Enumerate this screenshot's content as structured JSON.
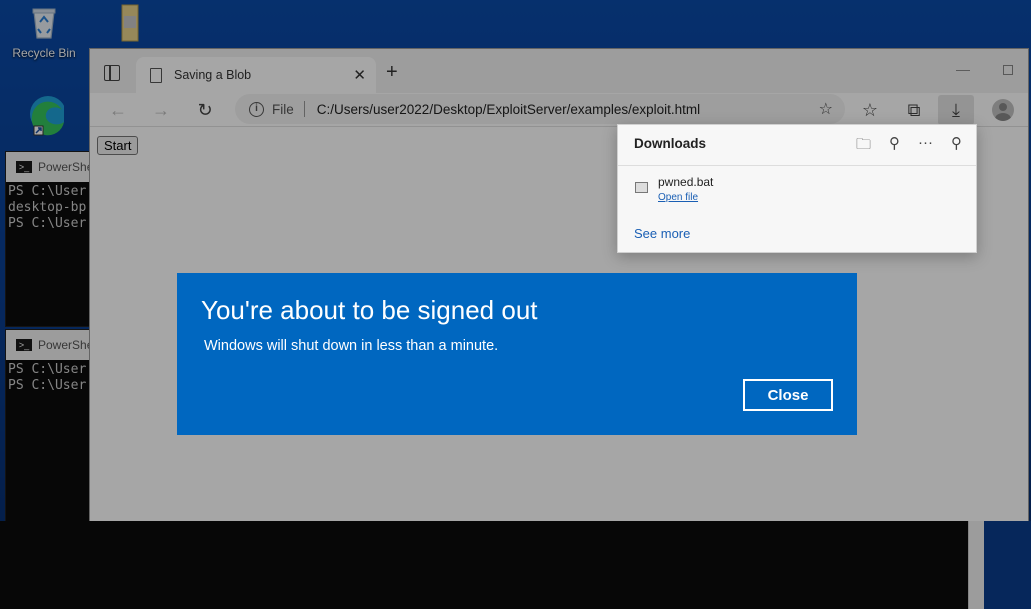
{
  "desktop": {
    "icons": [
      {
        "name": "recycle-bin",
        "label": "Recycle Bin"
      },
      {
        "name": "folder",
        "label": ""
      },
      {
        "name": "edge",
        "label": ""
      }
    ]
  },
  "powershell": {
    "window1": {
      "title": "PowerShe",
      "lines": [
        "PS C:\\User",
        "desktop-bp",
        "PS C:\\User"
      ]
    },
    "window2": {
      "title": "PowerShe",
      "lines": [
        "PS C:\\User",
        "PS C:\\User"
      ]
    }
  },
  "browser": {
    "tab": {
      "title": "Saving a Blob",
      "close": "✕"
    },
    "new_tab": "+",
    "address": {
      "scheme_label": "File",
      "url": "C:/Users/user2022/Desktop/ExploitServer/examples/exploit.html"
    },
    "page": {
      "start_button": "Start"
    }
  },
  "downloads": {
    "title": "Downloads",
    "item": {
      "filename": "pwned.bat",
      "action": "Open file"
    },
    "see_more": "See more"
  },
  "signout_dialog": {
    "title": "You're about to be signed out",
    "message": "Windows will shut down in less than a minute.",
    "close_label": "Close"
  },
  "colors": {
    "dialog_bg": "#0067c0",
    "link": "#1a5fb4",
    "desktop_bg": "#0a4aa8"
  }
}
